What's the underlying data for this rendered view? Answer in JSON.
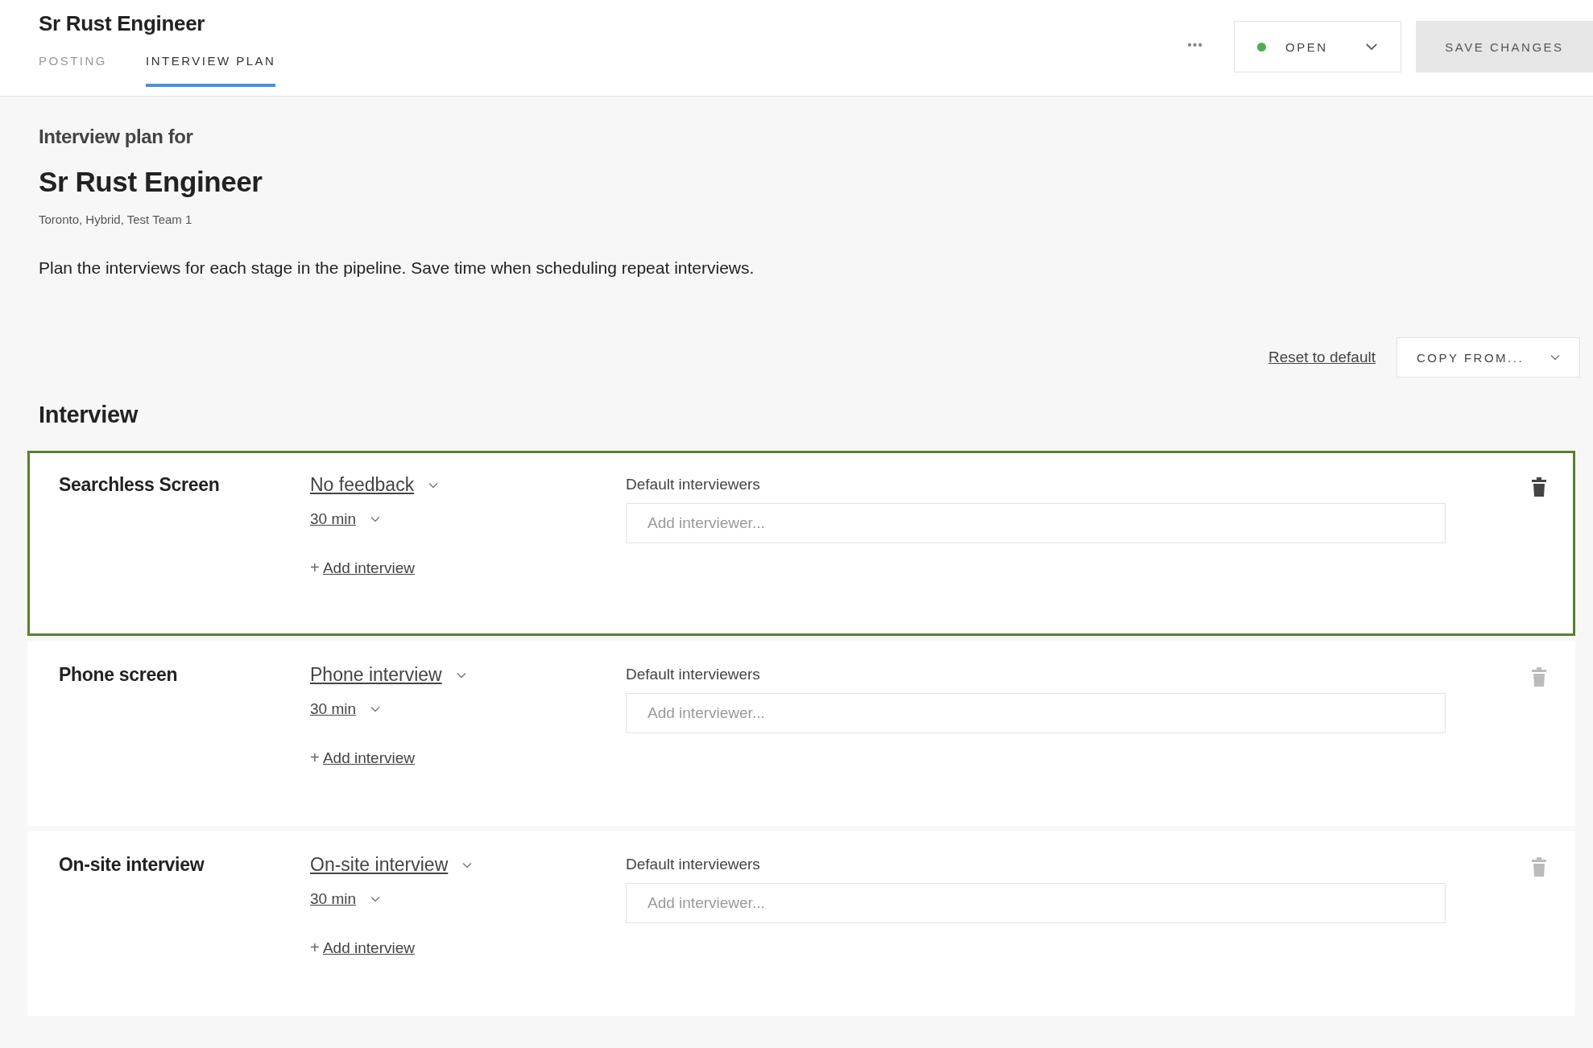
{
  "header": {
    "title": "Sr Rust Engineer",
    "tabs": [
      {
        "label": "POSTING",
        "selected": false
      },
      {
        "label": "INTERVIEW PLAN",
        "selected": true
      }
    ],
    "more": "•••",
    "status": {
      "label": "OPEN",
      "color": "#4caf50"
    },
    "save_button": "SAVE CHANGES"
  },
  "intro": {
    "kicker": "Interview plan for",
    "title": "Sr Rust Engineer",
    "meta": "Toronto, Hybrid, Test Team 1",
    "description": "Plan the interviews for each stage in the pipeline. Save time when scheduling repeat interviews."
  },
  "actions": {
    "reset_link": "Reset to default",
    "copy_button": "COPY FROM..."
  },
  "section_title": "Interview",
  "stages": [
    {
      "name": "Searchless Screen",
      "feedback": "No feedback",
      "duration": "30 min",
      "add_interview": "Add interview",
      "add_icon": "+",
      "interviewers_label": "Default interviewers",
      "placeholder": "Add interviewer...",
      "selected": true
    },
    {
      "name": "Phone screen",
      "feedback": "Phone interview",
      "duration": "30 min",
      "add_interview": "Add interview",
      "add_icon": "+",
      "interviewers_label": "Default interviewers",
      "placeholder": "Add interviewer...",
      "selected": false
    },
    {
      "name": "On-site interview",
      "feedback": "On-site interview",
      "duration": "30 min",
      "add_interview": "Add interview",
      "add_icon": "+",
      "interviewers_label": "Default interviewers",
      "placeholder": "Add interviewer...",
      "selected": false
    }
  ]
}
